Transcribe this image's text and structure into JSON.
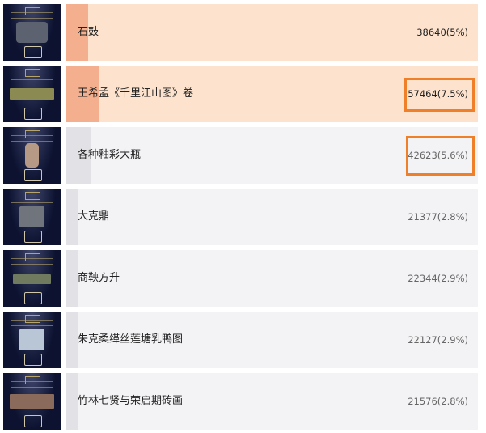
{
  "colors": {
    "highlight_bg": "#fde3cd",
    "highlight_fill": "#f4b08e",
    "normal_bg": "#f3f3f5",
    "normal_fill": "#e2e2e6",
    "accent_border": "#f07f2a"
  },
  "items": [
    {
      "name": "石鼓",
      "value": 38640,
      "pct_label": "38640(5%)",
      "share": 0.05,
      "highlight": true,
      "boxed": false
    },
    {
      "name": "王希孟《千里江山图》卷",
      "value": 57464,
      "pct_label": "57464(7.5%)",
      "share": 0.075,
      "highlight": true,
      "boxed": true
    },
    {
      "name": "各种釉彩大瓶",
      "value": 42623,
      "pct_label": "42623(5.6%)",
      "share": 0.056,
      "highlight": false,
      "boxed": true
    },
    {
      "name": "大克鼎",
      "value": 21377,
      "pct_label": "21377(2.8%)",
      "share": 0.028,
      "highlight": false,
      "boxed": false
    },
    {
      "name": "商鞅方升",
      "value": 22344,
      "pct_label": "22344(2.9%)",
      "share": 0.029,
      "highlight": false,
      "boxed": false
    },
    {
      "name": "朱克柔缂丝莲塘乳鸭图",
      "value": 22127,
      "pct_label": "22127(2.9%)",
      "share": 0.029,
      "highlight": false,
      "boxed": false
    },
    {
      "name": "竹林七贤与荣启期砖画",
      "value": 21576,
      "pct_label": "21576(2.8%)",
      "share": 0.028,
      "highlight": false,
      "boxed": false
    }
  ]
}
